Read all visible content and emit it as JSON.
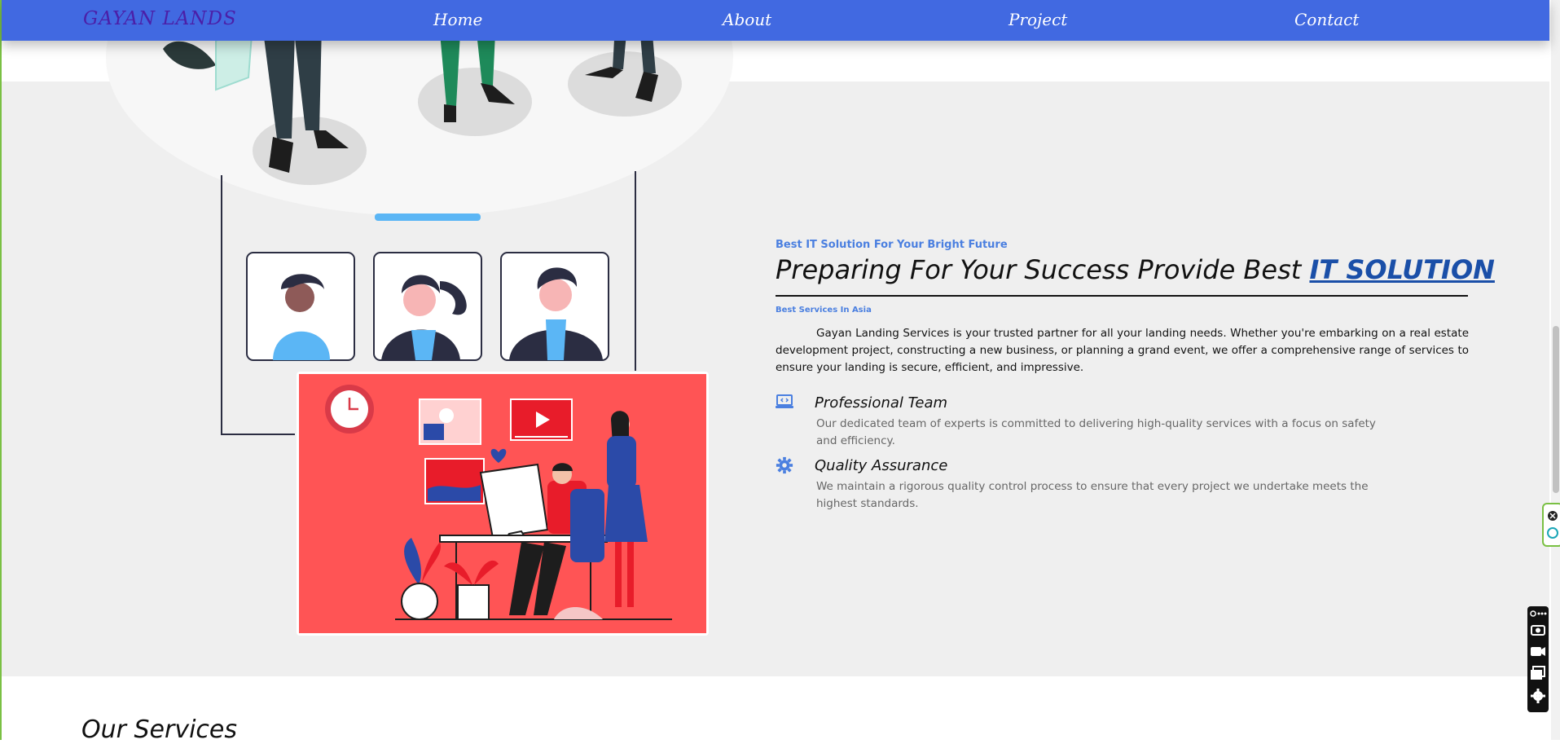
{
  "navbar": {
    "brand": "GAYAN LANDS",
    "links": [
      "Home",
      "About",
      "Project",
      "Contact"
    ]
  },
  "about": {
    "tagline": "Best IT Solution For Your Bright Future",
    "heading_prefix": "Preparing For Your Success Provide Best ",
    "heading_link": "IT SOLUTION",
    "subtag": "Best Services In Asia",
    "paragraph": "Gayan Landing Services is your trusted partner for all your landing needs. Whether you're embarking on a real estate development project, constructing a new business, or planning a grand event, we offer a comprehensive range of services to ensure your landing is secure, efficient, and impressive.",
    "features": [
      {
        "icon": "laptop-code-icon",
        "title": "Professional Team",
        "description": "Our dedicated team of experts is committed to delivering high-quality services with a focus on safety and efficiency."
      },
      {
        "icon": "gear-icon",
        "title": "Quality Assurance",
        "description": "We maintain a rigorous quality control process to ensure that every project we undertake meets the highest standards."
      }
    ]
  },
  "services": {
    "title": "Our Services"
  },
  "colors": {
    "nav_bg": "#4169e1",
    "brand": "#4b1fa8",
    "accent": "#4a7fe0",
    "link": "#1a4fa8",
    "section_bg": "#efefef",
    "illustration_red": "#ff5455"
  }
}
